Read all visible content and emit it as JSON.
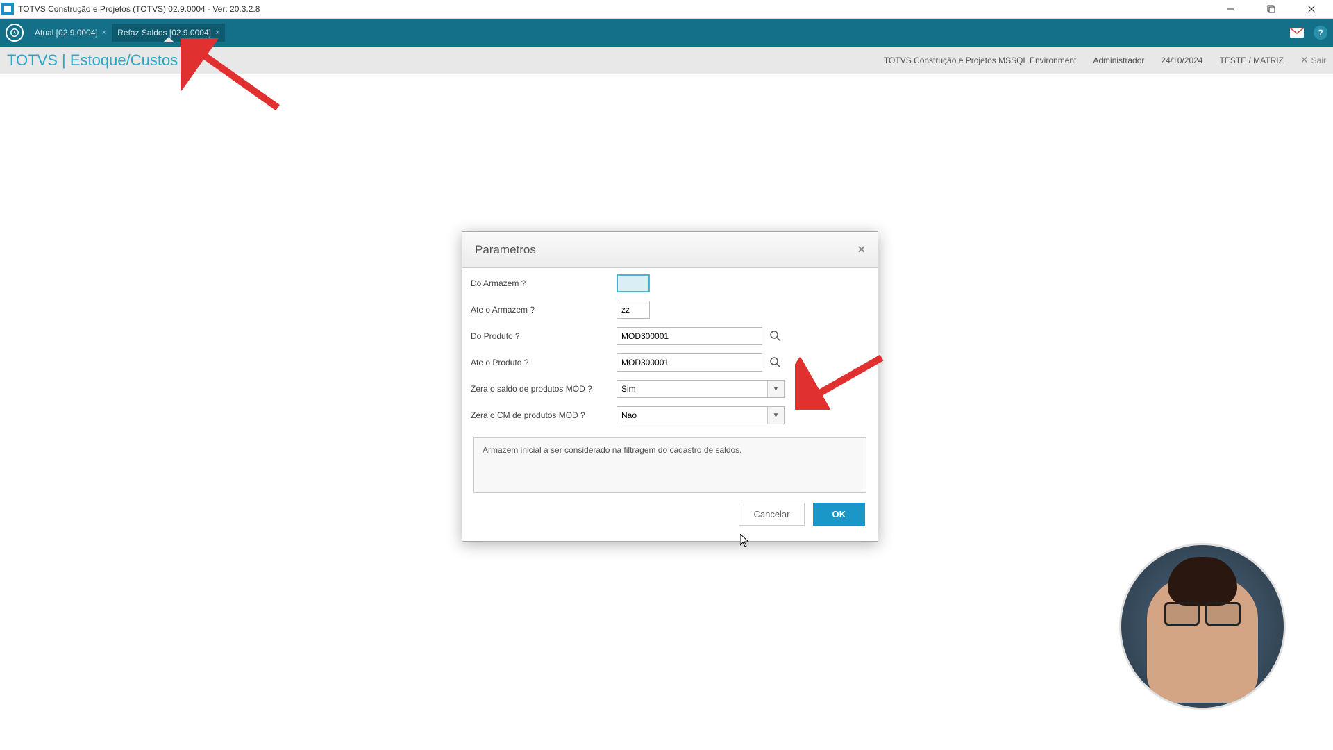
{
  "window": {
    "title": "TOTVS Construção e Projetos (TOTVS) 02.9.0004 - Ver: 20.3.2.8"
  },
  "tabs": {
    "tab1": {
      "label": "Atual [02.9.0004]"
    },
    "tab2": {
      "label": "Refaz Saldos [02.9.0004]"
    }
  },
  "breadcrumb": {
    "text": "TOTVS | Estoque/Custos",
    "environment": "TOTVS Construção e Projetos MSSQL Environment",
    "user": "Administrador",
    "date": "24/10/2024",
    "branch": "TESTE / MATRIZ",
    "exit": "Sair"
  },
  "dialog": {
    "title": "Parametros",
    "params": {
      "do_armazem": {
        "label": "Do  Armazem ?",
        "value": ""
      },
      "ate_armazem": {
        "label": "Ate o Armazem ?",
        "value": "zz"
      },
      "do_produto": {
        "label": "Do Produto ?",
        "value": "MOD300001"
      },
      "ate_produto": {
        "label": "Ate o Produto ?",
        "value": "MOD300001"
      },
      "zera_saldo_mod": {
        "label": "Zera o saldo de produtos MOD ?",
        "value": "Sim"
      },
      "zera_cm_mod": {
        "label": "Zera o CM de produtos MOD ?",
        "value": "Nao"
      }
    },
    "help_text": "Armazem inicial a ser considerado na filtragem do cadastro de saldos.",
    "cancel": "Cancelar",
    "ok": "OK"
  }
}
